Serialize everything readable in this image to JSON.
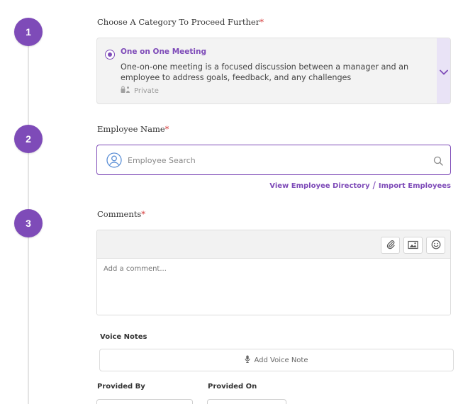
{
  "steps": [
    "1",
    "2",
    "3"
  ],
  "category": {
    "label": "Choose A Category To Proceed Further",
    "required_mark": "*",
    "selected": {
      "title": "One on One Meeting",
      "description": "One-on-one meeting is a focused discussion between a manager and an employee to address goals, feedback, and any challenges",
      "visibility": "Private",
      "visibility_icon": "private-lock-icon"
    },
    "toggle_icon": "chevron-down-icon"
  },
  "employee": {
    "label": "Employee Name",
    "required_mark": "*",
    "search_placeholder": "Employee Search",
    "search_value": "",
    "avatar_icon": "user-icon",
    "search_icon": "search-icon",
    "directory_link": "View Employee Directory",
    "separator": "/",
    "import_link": "Import Employees"
  },
  "comments": {
    "label": "Comments",
    "required_mark": "*",
    "placeholder": "Add a comment...",
    "value": "",
    "tools": [
      "paperclip-icon",
      "image-icon",
      "smiley-icon"
    ]
  },
  "voice": {
    "label": "Voice Notes",
    "button_label": "Add Voice Note",
    "button_icon": "microphone-icon"
  },
  "provided_by_label": "Provided By",
  "provided_on_label": "Provided On",
  "colors": {
    "accent": "#7e4bb8",
    "required": "#d32f2f",
    "card_bg": "#f3f3f3",
    "toggle_bg": "#e9e3f6"
  }
}
